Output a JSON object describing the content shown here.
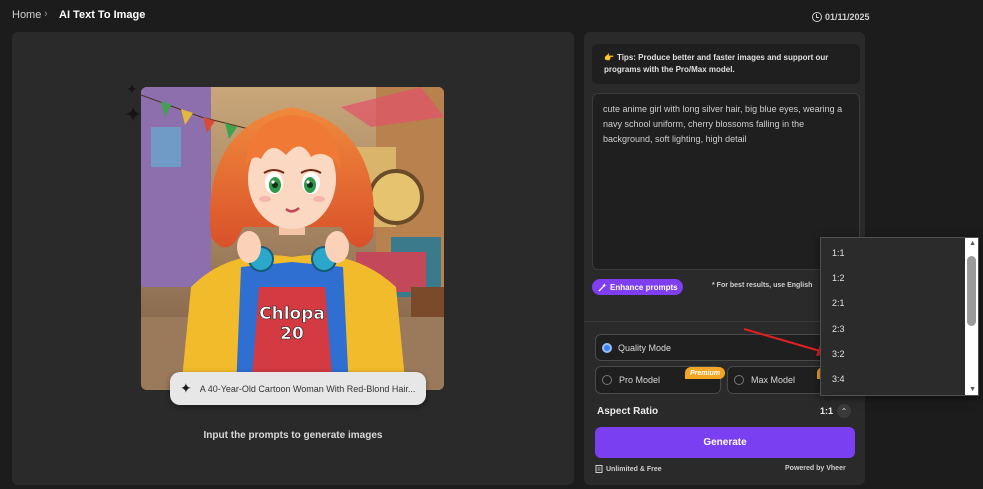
{
  "breadcrumb": {
    "home": "Home",
    "separator": "›",
    "current": "AI Text To Image"
  },
  "date": "01/11/2025",
  "preview": {
    "prompt_chip": "A 40-Year-Old Cartoon Woman With Red-Blond Hair...",
    "shirt_text_line1": "Chlopa",
    "shirt_text_line2": "20",
    "hint": "Input the prompts to generate images"
  },
  "tips": {
    "icon": "👉",
    "text": "Tips: Produce better and faster images and support our programs with the Pro/Max model."
  },
  "prompt": {
    "value": "cute anime girl with long silver hair, big blue eyes, wearing a navy school uniform, cherry blossoms falling in the background, soft lighting, high detail"
  },
  "enhance": {
    "label": "Enhance prompts"
  },
  "best_results": "* For best results, use English",
  "modes": {
    "quality": "Quality Mode",
    "pro": "Pro Model",
    "max": "Max Model",
    "premium": "Premium"
  },
  "aspect": {
    "label": "Aspect Ratio",
    "value": "1:1",
    "toggle": "⌃"
  },
  "generate": {
    "label": "Generate"
  },
  "footer": {
    "unlimited": "Unlimited & Free",
    "powered": "Powered by Vheer"
  },
  "dropdown": {
    "options": [
      "1:1",
      "1:2",
      "2:1",
      "2:3",
      "3:2",
      "3:4"
    ],
    "up": "▲",
    "down": "▼"
  },
  "colors": {
    "accent": "#7b3ff2",
    "radio": "#3b82f6",
    "premium": "#f5a524",
    "annotation_arrow": "#e02020"
  }
}
